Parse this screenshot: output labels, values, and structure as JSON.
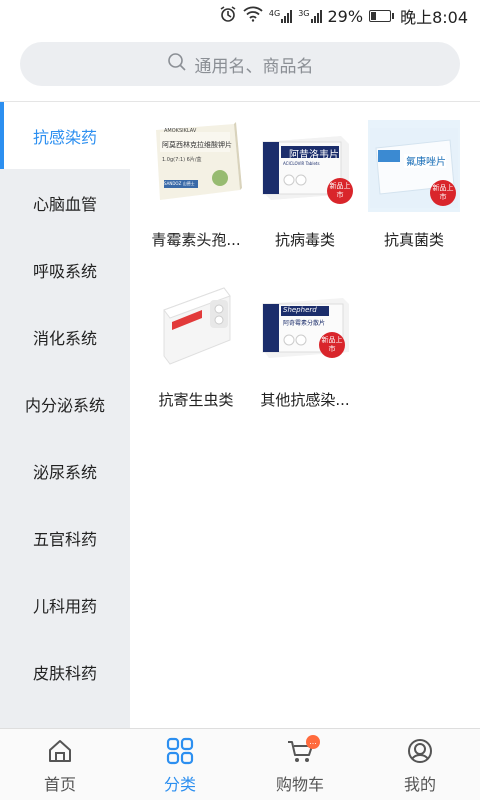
{
  "status_bar": {
    "network_a": "4G",
    "network_b": "3G",
    "battery": "29%",
    "battery_level": 0.29,
    "time": "晚上8:04"
  },
  "search": {
    "placeholder": "通用名、商品名"
  },
  "sidebar": {
    "items": [
      {
        "label": "抗感染药",
        "active": true
      },
      {
        "label": "心脑血管"
      },
      {
        "label": "呼吸系统"
      },
      {
        "label": "消化系统"
      },
      {
        "label": "内分泌系统"
      },
      {
        "label": "泌尿系统"
      },
      {
        "label": "五官科药"
      },
      {
        "label": "儿科用药"
      },
      {
        "label": "皮肤科药"
      }
    ]
  },
  "categories": [
    {
      "label": "青霉素头孢...",
      "box_brand": "AMOKSIKLAV",
      "box_line2": "阿莫西林克拉维酸钾片",
      "box_line3": "1.0g(7:1) 6片/盒",
      "box_maker": "SANDOZ 山德士"
    },
    {
      "label": "抗病毒类",
      "box_brand": "阿昔洛韦片",
      "box_line2": "ACICLOVIR Tablets",
      "badge": "新品上市"
    },
    {
      "label": "抗真菌类",
      "box_brand": "氟康唑片",
      "badge": "新品上市"
    },
    {
      "label": "抗寄生虫类"
    },
    {
      "label": "其他抗感染...",
      "box_brand": "Shepherd",
      "box_line2": "阿奇霉素分散片",
      "badge": "新品上市"
    }
  ],
  "tabbar": {
    "tabs": [
      {
        "label": "首页",
        "icon": "home-icon"
      },
      {
        "label": "分类",
        "icon": "category-icon",
        "active": true
      },
      {
        "label": "购物车",
        "icon": "cart-icon",
        "badge": "..."
      },
      {
        "label": "我的",
        "icon": "profile-icon"
      }
    ]
  },
  "colors": {
    "accent": "#2c8ff0",
    "sidebar_bg": "#eceef1",
    "badge_red": "#d9252b",
    "cart_badge": "#ff6a3d"
  }
}
